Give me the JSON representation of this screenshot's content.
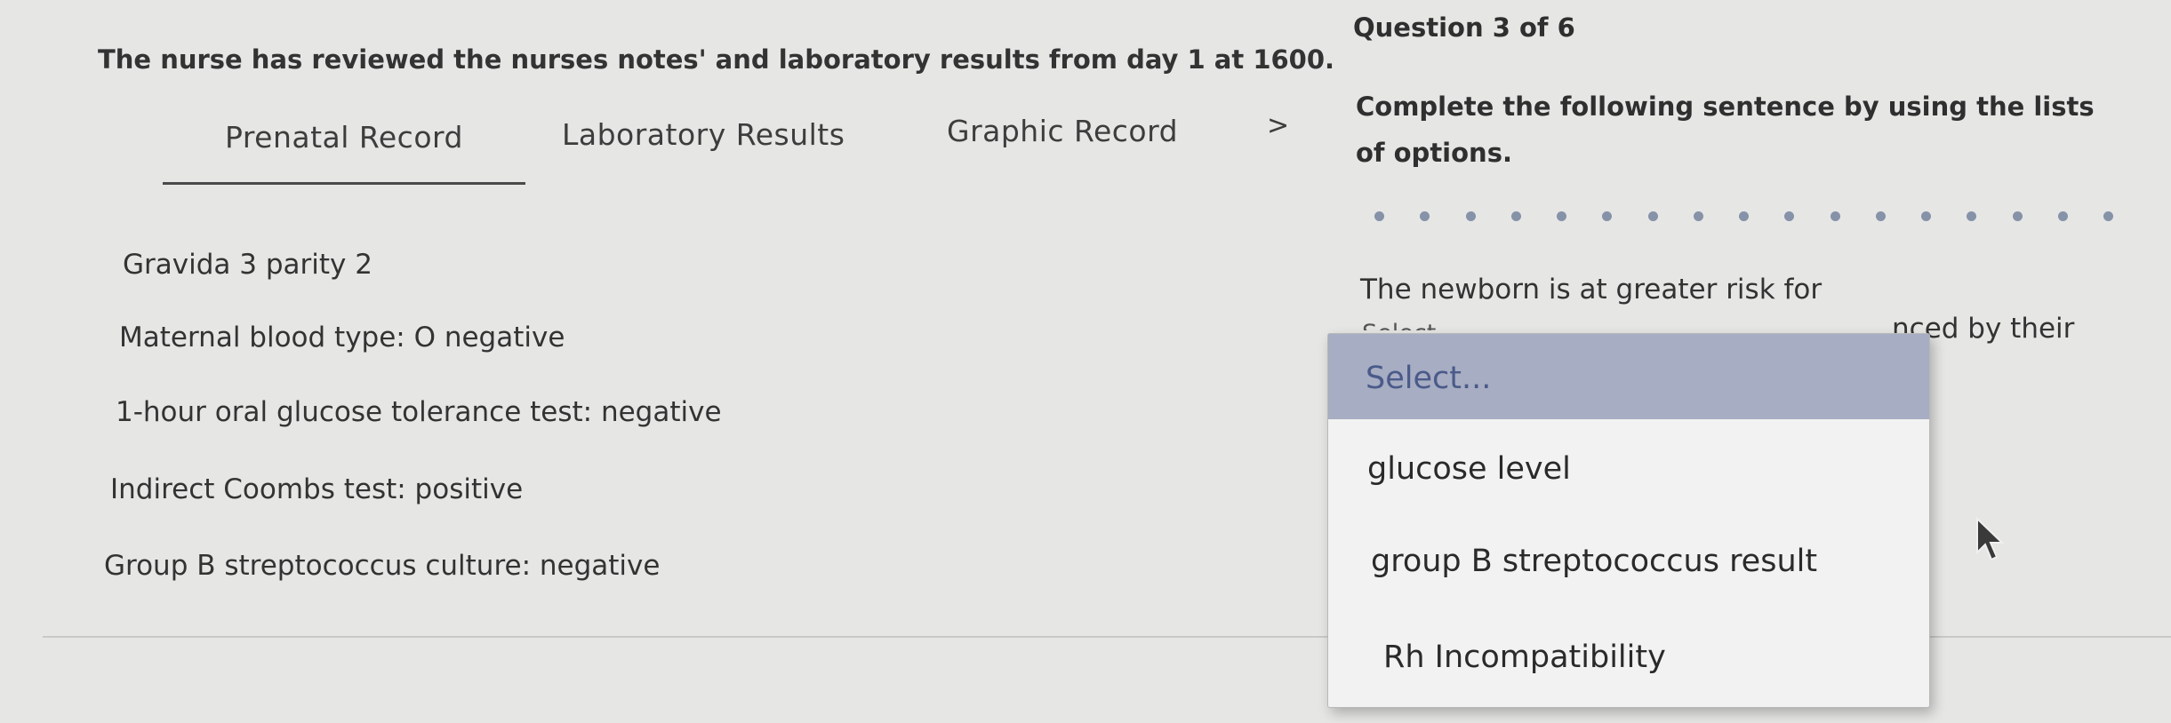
{
  "intro": "The nurse has reviewed the nurses notes' and laboratory results from day 1 at 1600.",
  "tabs": [
    {
      "label": "Prenatal Record",
      "active": true
    },
    {
      "label": "Laboratory Results",
      "active": false
    },
    {
      "label": "Graphic Record",
      "active": false
    }
  ],
  "next_icon": "chevron-right-icon",
  "next_glyph": ">",
  "prenatal_record": [
    "Gravida 3 parity 2",
    "Maternal blood type: O negative",
    "1-hour oral glucose tolerance test: negative",
    "Indirect Coombs test: positive",
    "Group B streptococcus culture: negative"
  ],
  "question": {
    "number": "Question 3 of 6",
    "instruction": "Complete the following sentence by using the lists of options.",
    "progress_dots": 17,
    "sentence_start": "The newborn is at greater risk for",
    "sentence_tail": "nced by their",
    "select_peek": "Select"
  },
  "dropdown": {
    "selected": "Select...",
    "options": [
      "glucose level",
      "group B streptococcus result",
      "Rh Incompatibility"
    ]
  },
  "colors": {
    "background": "#e6e6e4",
    "dropdown_highlight": "#a7adc2",
    "selected_text": "#4a5a8a",
    "dot": "#8592a8"
  }
}
